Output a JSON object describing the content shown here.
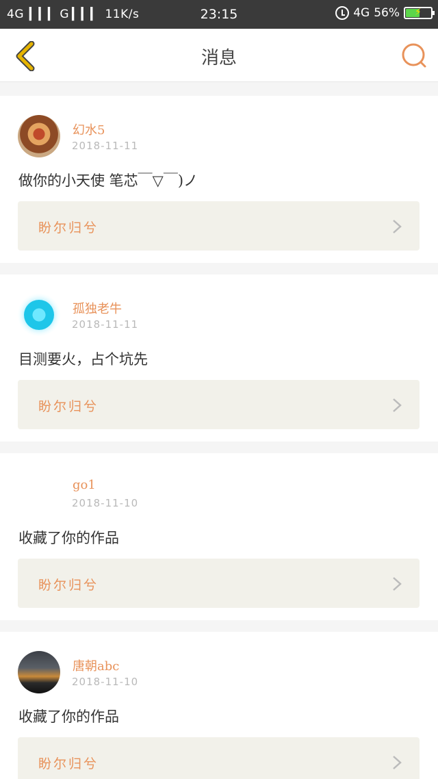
{
  "statusbar": {
    "left": "4G  ▎▎▎ G ▎▎▎  11K/s",
    "time": "23:15",
    "network": "4G",
    "battery_percent": "56%",
    "battery_level": 0.56
  },
  "navbar": {
    "title": "消息",
    "back_icon": "chevron-left-icon",
    "search_icon": "search-icon"
  },
  "colors": {
    "accent": "#e8925a",
    "back": "#e6b400",
    "link_bg": "#f2f1ea"
  },
  "messages": [
    {
      "username": "幻水5",
      "date": "2018-11-11",
      "content": "做你的小天使 笔芯￣▽￣)ノ",
      "link": "盼尔归兮"
    },
    {
      "username": "孤独老牛",
      "date": "2018-11-11",
      "content": "目测要火，占个坑先",
      "link": "盼尔归兮"
    },
    {
      "username": "go1",
      "date": "2018-11-10",
      "content": "收藏了你的作品",
      "link": "盼尔归兮"
    },
    {
      "username": "唐朝abc",
      "date": "2018-11-10",
      "content": "收藏了你的作品",
      "link": "盼尔归兮"
    }
  ]
}
